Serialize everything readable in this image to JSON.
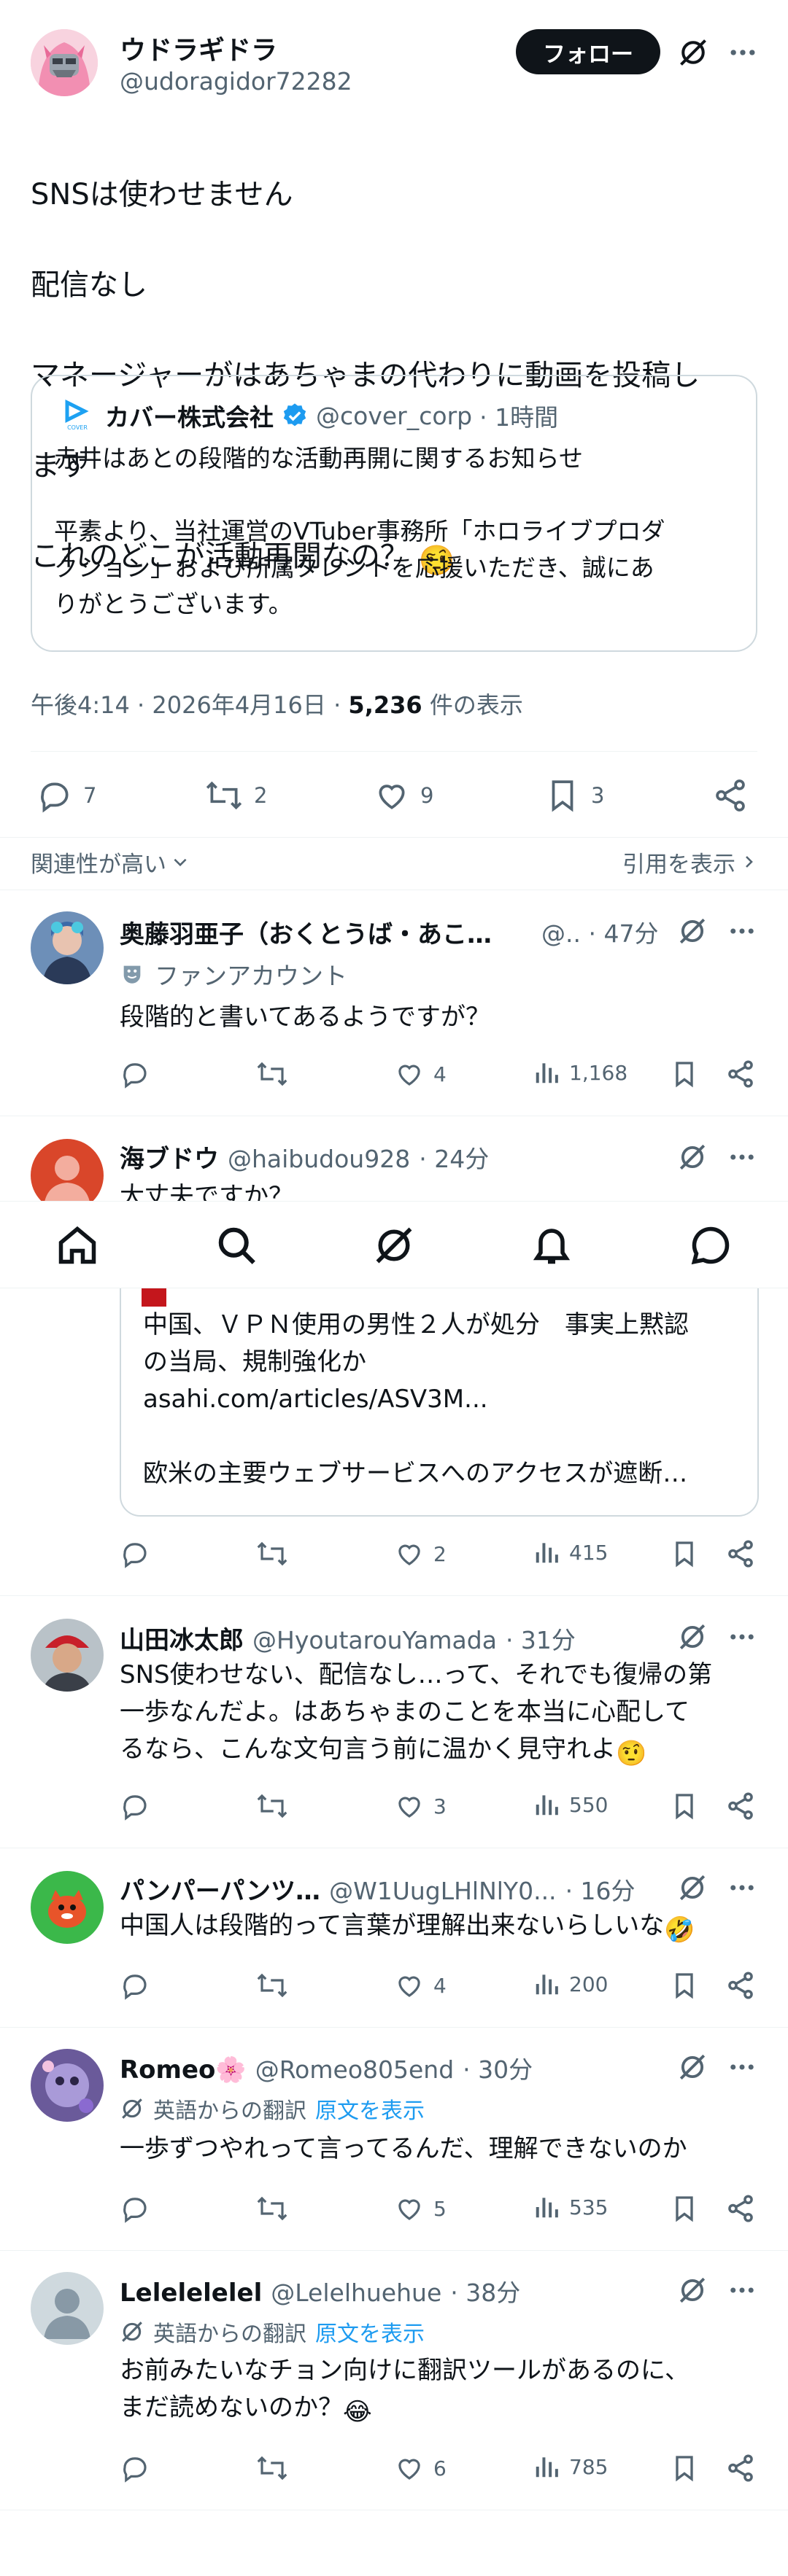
{
  "post": {
    "author_name": "ウドラギドラ",
    "author_handle": "@udoragidor72282",
    "follow_label": "フォロー",
    "text_lines": [
      "SNSは使わせません",
      "配信なし",
      "マネージャーがはあちゃまの代わりに動画を投稿し",
      "ます",
      "これのどこが活動再開なの？"
    ],
    "emoji": "🤨",
    "quote": {
      "author_name": "カバー株式会社",
      "author_handle": "@cover_corp",
      "time": "· 1時間",
      "logo_text": "COVER",
      "line1": "赤井はあとの段階的な活動再開に関するお知らせ",
      "line2": "平素より、当社運営のVTuber事務所「ホロライブプロダ",
      "line3": "クション」および所属タレントを応援いただき、誠にあ",
      "line4": "りがとうございます。"
    },
    "time": "午後4:14 · 2026年4月16日 ·",
    "views_count": "5,236",
    "views_label": "件の表示",
    "stats": {
      "replies": "7",
      "reposts": "2",
      "likes": "9",
      "bookmarks": "3"
    }
  },
  "sort": {
    "label": "関連性が高い",
    "quotes_label": "引用を表示"
  },
  "replies": [
    {
      "name": "奥藤羽亜子（おくとうば・あこ…",
      "handle": "@..",
      "time": "· 47分",
      "badge": "ファンアカウント",
      "text": "段階的と書いてあるようですが？",
      "likes": "4",
      "views": "1,168"
    },
    {
      "name": "海ブドウ",
      "handle": "@haibudou928",
      "time": "· 24分",
      "text": "大丈夫ですか？"
    },
    {
      "card_line1": "中国、ＶＰＮ使用の男性２人が処分　事実上黙認",
      "card_line2": "の当局、規制強化か",
      "card_line3": "asahi.com/articles/ASV3M...",
      "card_line4": "欧米の主要ウェブサービスへのアクセスが遮断…",
      "likes": "2",
      "views": "415"
    },
    {
      "name": "山田冰太郎",
      "handle": "@HyoutarouYamada",
      "time": "· 31分",
      "line1": "SNS使わせない、配信なし…って、それでも復帰の第",
      "line2": "一歩なんだよ。はあちゃまのことを本当に心配して",
      "line3": "るなら、こんな文句言う前に温かく見守れよ",
      "emoji": "🤨",
      "likes": "3",
      "views": "550"
    },
    {
      "name": "パンパーパンツ…",
      "handle": "@W1UugLHlNlY0...",
      "time": "· 16分",
      "text": "中国人は段階的って言葉が理解出来ないらしいな",
      "emoji": "🤣",
      "likes": "4",
      "views": "200"
    },
    {
      "name": "Romeo",
      "name_emoji": "🌸",
      "handle": "@Romeo805end",
      "time": "· 30分",
      "translate_label": "英語からの翻訳",
      "original_label": "原文を表示",
      "text": "一歩ずつやれって言ってるんだ、理解できないのか",
      "likes": "5",
      "views": "535"
    },
    {
      "name": "Lelelelelel",
      "handle": "@Lelelhuehue",
      "time": "· 38分",
      "translate_label": "英語からの翻訳",
      "original_label": "原文を表示",
      "line1": "お前みたいなチョン向けに翻訳ツールがあるのに、",
      "line2": "まだ読めないのか？",
      "emoji": "😂",
      "likes": "6",
      "views": "785"
    }
  ],
  "nav": [
    "home-icon",
    "search-icon",
    "grok-icon",
    "notifications-icon",
    "messages-icon"
  ]
}
